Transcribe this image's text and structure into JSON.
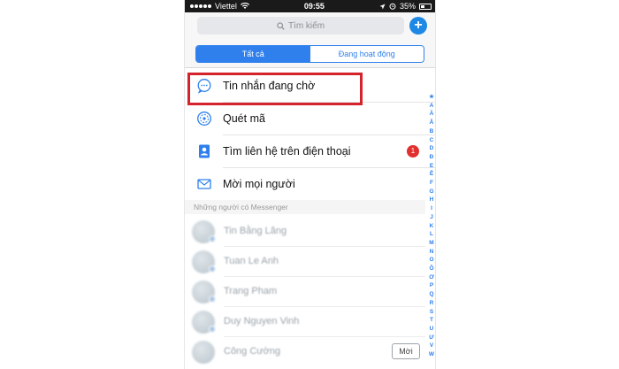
{
  "status_bar": {
    "carrier": "Viettel",
    "time": "09:55",
    "battery": "35%"
  },
  "search": {
    "placeholder": "Tìm kiếm",
    "add_label": "+"
  },
  "segments": [
    {
      "label": "Tất cả",
      "active": true
    },
    {
      "label": "Đang hoạt động",
      "active": false
    }
  ],
  "menu_items": [
    {
      "label": "Tin nhắn đang chờ",
      "icon": "chat-bubble-icon",
      "highlighted": true
    },
    {
      "label": "Quét mã",
      "icon": "qr-scan-icon"
    },
    {
      "label": "Tìm liên hệ trên điện thoại",
      "icon": "contact-card-icon",
      "badge": "1"
    },
    {
      "label": "Mời mọi người",
      "icon": "envelope-icon"
    }
  ],
  "section_header": "Những người có Messenger",
  "contacts": [
    {
      "name": "Tin Bằng Lăng"
    },
    {
      "name": "Tuan Le Anh"
    },
    {
      "name": "Trang Pham"
    },
    {
      "name": "Duy Nguyen Vinh"
    },
    {
      "name": "Công Cường",
      "action": "Mời"
    }
  ],
  "index_letters": [
    "★",
    "A",
    "Ă",
    "Â",
    "B",
    "C",
    "D",
    "Đ",
    "E",
    "Ê",
    "F",
    "G",
    "H",
    "I",
    "J",
    "K",
    "L",
    "M",
    "N",
    "O",
    "Ô",
    "Ơ",
    "P",
    "Q",
    "R",
    "S",
    "T",
    "U",
    "Ư",
    "V",
    "W"
  ],
  "colors": {
    "accent": "#2f80ed",
    "highlight_border": "#d4232b",
    "badge": "#e0312f",
    "status_bar": "#1a1a1a"
  }
}
